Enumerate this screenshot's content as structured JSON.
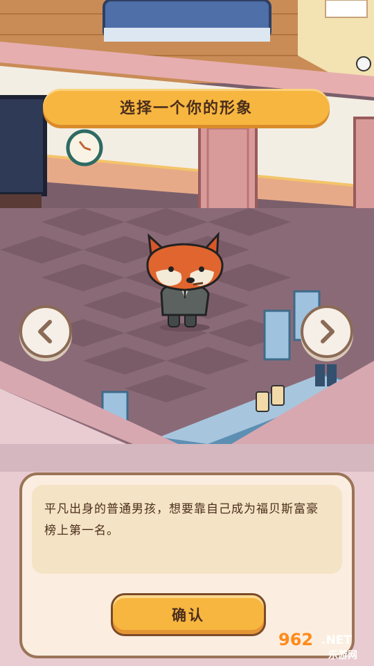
{
  "banner": {
    "title": "选择一个你的形象"
  },
  "nav": {
    "prev_glyph": "‹",
    "next_glyph": "›"
  },
  "character": {
    "name": "fox in suit"
  },
  "panel": {
    "description": "平凡出身的普通男孩，想要靠自己成为福贝斯富豪榜上第一名。",
    "confirm_label": "确认"
  },
  "watermark": {
    "main": "962",
    "net": ".NET",
    "cn": "乐游网"
  },
  "colors": {
    "accent": "#f7b640",
    "accent_dark": "#d98b2b",
    "text": "#4a2e1c",
    "panel_bg": "#fbeee0",
    "floor": "#8a6b78"
  }
}
